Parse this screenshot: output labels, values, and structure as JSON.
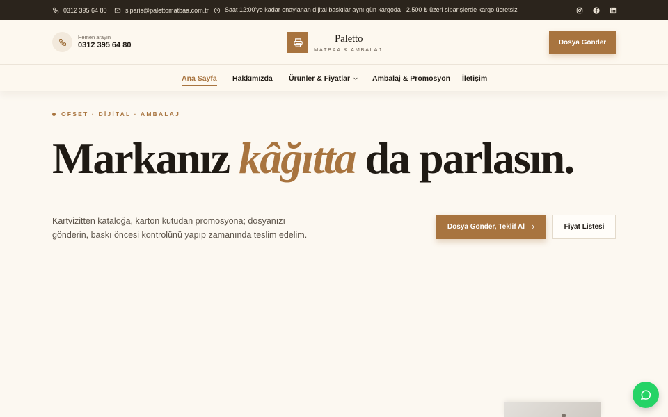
{
  "topbar": {
    "phone": "0312 395 64 80",
    "email": "siparis@palettomatbaa.com.tr",
    "notice": "Saat 12:00'ye kadar onaylanan dijital baskılar aynı gün kargoda · 2.500 ₺ üzeri siparişlerde kargo ücretsiz",
    "social_icons": [
      "instagram-icon",
      "facebook-icon",
      "linkedin-icon"
    ]
  },
  "header": {
    "call_label": "Hemen arayın",
    "call_number": "0312 395 64 80",
    "logo_name": "Paletto",
    "logo_sub": "MATBAA & AMBALAJ",
    "cta_label": "Dosya Gönder"
  },
  "nav": {
    "items": [
      {
        "label": "Ana Sayfa",
        "active": true
      },
      {
        "label": "Hakkımızda"
      },
      {
        "label": "Ürünler & Fiyatlar",
        "has_dropdown": true
      },
      {
        "label": "Ambalaj & Promosyon"
      },
      {
        "label": "İletişim"
      }
    ]
  },
  "hero": {
    "eyebrow": "OFSET · DİJİTAL · AMBALAJ",
    "headline_pre": "Markanız ",
    "headline_accent": "kâğıtta",
    "headline_post": " da parlasın.",
    "description": "Kartvizitten kataloğa, karton kutudan promosyona; dosyanızı gönderin, baskı öncesi kontrolünü yapıp zamanında teslim edelim.",
    "primary_cta": "Dosya Gönder, Teklif Al",
    "secondary_cta": "Fiyat Listesi"
  },
  "colors": {
    "accent": "#a8743f",
    "topbar_bg": "#2b241c",
    "page_bg": "#fcf8f1",
    "chat": "#25d366"
  }
}
